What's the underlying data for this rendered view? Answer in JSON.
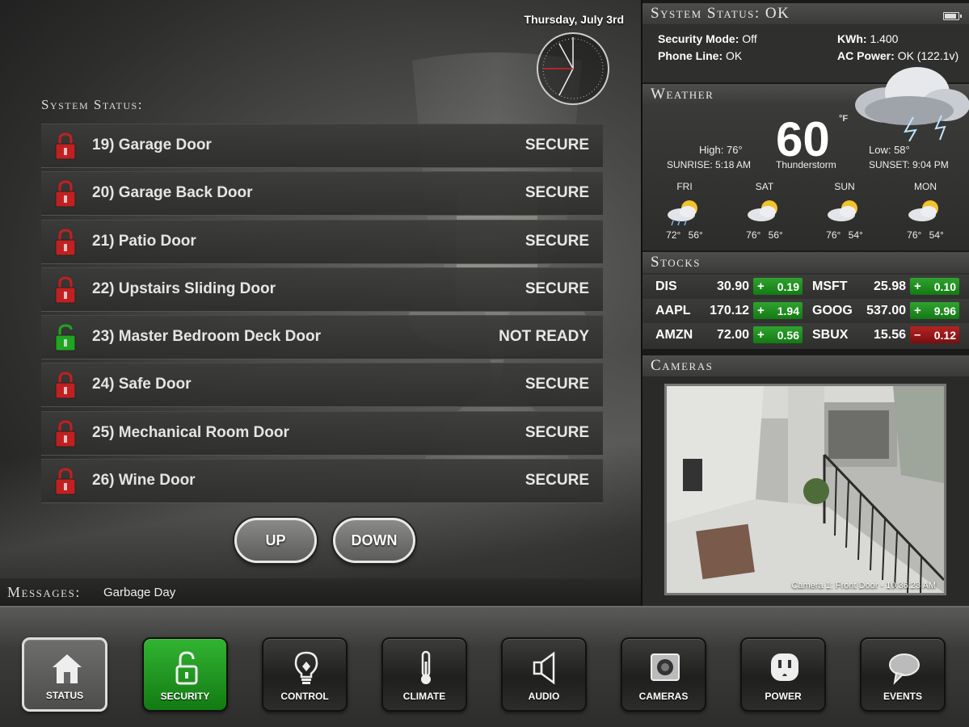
{
  "main": {
    "date": "Thursday, July 3rd",
    "status_heading": "System Status:",
    "zones": [
      {
        "name": "19) Garage Door",
        "state": "SECURE",
        "locked": true
      },
      {
        "name": "20) Garage Back Door",
        "state": "SECURE",
        "locked": true
      },
      {
        "name": "21) Patio Door",
        "state": "SECURE",
        "locked": true
      },
      {
        "name": "22) Upstairs Sliding Door",
        "state": "SECURE",
        "locked": true
      },
      {
        "name": "23) Master Bedroom Deck Door",
        "state": "NOT READY",
        "locked": false
      },
      {
        "name": "24) Safe Door",
        "state": "SECURE",
        "locked": true
      },
      {
        "name": "25) Mechanical Room Door",
        "state": "SECURE",
        "locked": true
      },
      {
        "name": "26) Wine Door",
        "state": "SECURE",
        "locked": true
      }
    ],
    "up_label": "UP",
    "down_label": "DOWN",
    "messages_label": "Messages:",
    "messages_text": "Garbage Day",
    "colors": {
      "locked": "#cc1f1f",
      "unlocked": "#1fae1f"
    }
  },
  "system": {
    "heading": "System Status: OK",
    "security_mode_label": "Security Mode:",
    "security_mode_value": "Off",
    "phone_line_label": "Phone Line:",
    "phone_line_value": "OK",
    "kwh_label": "KWh:",
    "kwh_value": "1.400",
    "ac_power_label": "AC Power:",
    "ac_power_value": "OK (122.1v)"
  },
  "weather": {
    "heading": "Weather",
    "temp": "60",
    "unit": "°F",
    "condition": "Thunderstorm",
    "condition_icon": "thunderstorm-icon",
    "high": "High: 76°",
    "low": "Low: 58°",
    "sunrise": "SUNRISE: 5:18 AM",
    "sunset": "SUNSET: 9:04 PM",
    "forecast": [
      {
        "day": "FRI",
        "hi": "72°",
        "lo": "56°",
        "icon": "rain-sun-icon"
      },
      {
        "day": "SAT",
        "hi": "76°",
        "lo": "56°",
        "icon": "partly-cloudy-icon"
      },
      {
        "day": "SUN",
        "hi": "76°",
        "lo": "54°",
        "icon": "partly-cloudy-icon"
      },
      {
        "day": "MON",
        "hi": "76°",
        "lo": "54°",
        "icon": "partly-cloudy-icon"
      }
    ]
  },
  "stocks": {
    "heading": "Stocks",
    "items": [
      {
        "symbol": "DIS",
        "price": "30.90",
        "sign": "+",
        "change": "0.19",
        "up": true
      },
      {
        "symbol": "MSFT",
        "price": "25.98",
        "sign": "+",
        "change": "0.10",
        "up": true
      },
      {
        "symbol": "AAPL",
        "price": "170.12",
        "sign": "+",
        "change": "1.94",
        "up": true
      },
      {
        "symbol": "GOOG",
        "price": "537.00",
        "sign": "+",
        "change": "9.96",
        "up": true
      },
      {
        "symbol": "AMZN",
        "price": "72.00",
        "sign": "+",
        "change": "0.56",
        "up": true
      },
      {
        "symbol": "SBUX",
        "price": "15.56",
        "sign": "–",
        "change": "0.12",
        "up": false
      }
    ]
  },
  "cameras": {
    "heading": "Cameras",
    "caption": "Camera 1: Front Door - 10:36:23 AM"
  },
  "nav": [
    {
      "label": "STATUS",
      "icon": "home-icon"
    },
    {
      "label": "SECURITY",
      "icon": "unlocked-padlock-icon"
    },
    {
      "label": "CONTROL",
      "icon": "lightbulb-icon"
    },
    {
      "label": "CLIMATE",
      "icon": "thermometer-icon"
    },
    {
      "label": "AUDIO",
      "icon": "speaker-icon"
    },
    {
      "label": "CAMERAS",
      "icon": "camera-icon"
    },
    {
      "label": "POWER",
      "icon": "power-outlet-icon"
    },
    {
      "label": "EVENTS",
      "icon": "speech-bubble-icon"
    }
  ]
}
